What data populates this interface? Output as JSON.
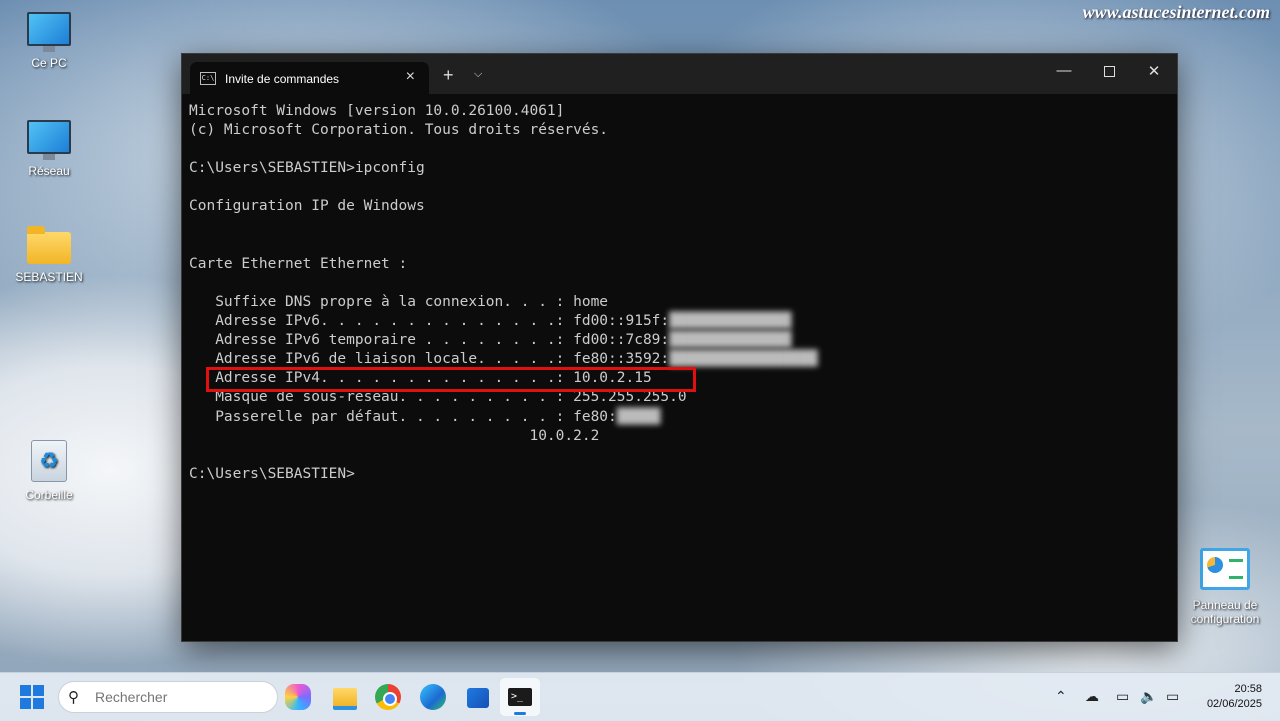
{
  "watermark": "www.astucesinternet.com",
  "desktop": {
    "icons": [
      {
        "label": "Ce PC",
        "icon": "this-pc-icon"
      },
      {
        "label": "Réseau",
        "icon": "network-icon"
      },
      {
        "label": "SEBASTIEN",
        "icon": "user-folder-icon"
      },
      {
        "label": "Corbeille",
        "icon": "recycle-bin-icon"
      },
      {
        "label": "Panneau de configuration",
        "icon": "control-panel-icon"
      }
    ]
  },
  "terminal": {
    "tab_title": "Invite de commandes",
    "new_tab_symbol": "+",
    "dropdown_symbol": "⌵",
    "lines": [
      "Microsoft Windows [version 10.0.26100.4061]",
      "(c) Microsoft Corporation. Tous droits réservés.",
      "",
      "C:\\Users\\SEBASTIEN>ipconfig",
      "",
      "Configuration IP de Windows",
      "",
      "",
      "Carte Ethernet Ethernet :",
      "",
      "   Suffixe DNS propre à la connexion. . . : home",
      "   Adresse IPv6. . . . . . . . . . . . . .: fd00::915f:",
      "   Adresse IPv6 temporaire . . . . . . . .: fd00::7c89:",
      "   Adresse IPv6 de liaison locale. . . . .: fe80::3592:",
      "   Adresse IPv4. . . . . . . . . . . . . .: 10.0.2.15",
      "   Masque de sous-réseau. . . . . . . . . : 255.255.255.0",
      "   Passerelle par défaut. . . . . . . . . : fe80:",
      "                                       10.0.2.2",
      "",
      "C:\\Users\\SEBASTIEN>"
    ],
    "redacted": [
      "",
      "",
      "",
      "",
      "",
      "",
      "",
      "",
      "",
      "",
      "",
      "██████████████",
      "██████████████",
      "█████████████████",
      "",
      "",
      "█████",
      "",
      "",
      ""
    ]
  },
  "taskbar": {
    "search_placeholder": "Rechercher",
    "apps": [
      "copilot-icon",
      "file-explorer-icon",
      "chrome-icon",
      "edge-icon",
      "store-icon",
      "terminal-icon"
    ],
    "time": "20:58",
    "date": "02/06/2025"
  },
  "colors": {
    "highlight_border": "#e01010",
    "console_bg": "#0c0c0c",
    "console_text": "#cccccc",
    "accent": "#1f7ae0"
  }
}
